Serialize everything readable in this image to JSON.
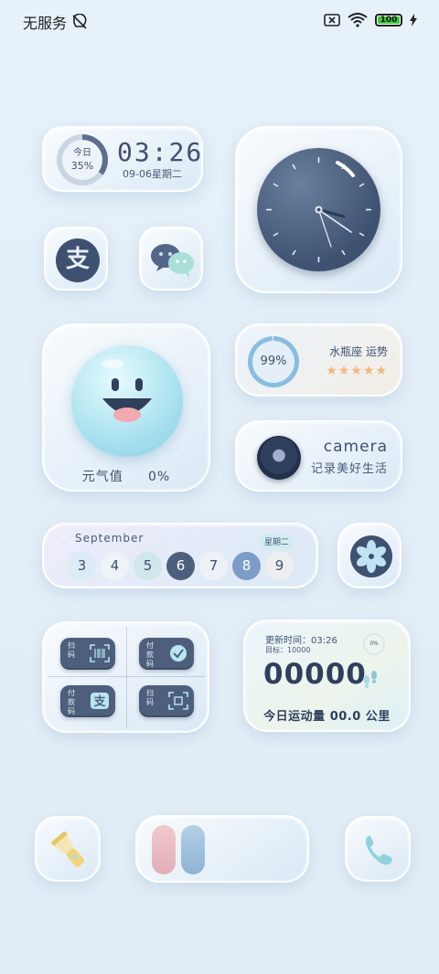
{
  "status_bar": {
    "carrier": "无服务",
    "battery_level": "100"
  },
  "time_widget": {
    "ring_label": "今日",
    "ring_percent": "35%",
    "ring_fraction": 0.35,
    "time": "03:26",
    "date": "09-06星期二"
  },
  "mood_widget": {
    "label": "元气值",
    "value": "0%"
  },
  "horoscope_widget": {
    "percent": "99%",
    "title": "水瓶座 运势",
    "stars": "★★★★★"
  },
  "camera_widget": {
    "title": "camera",
    "subtitle": "记录美好生活"
  },
  "calendar_widget": {
    "month": "September",
    "weekday": "星期二",
    "days": [
      {
        "label": "3",
        "bg": "#dcebf5",
        "fg": "#3f5170"
      },
      {
        "label": "4",
        "bg": "#eef3f8",
        "fg": "#3f5170"
      },
      {
        "label": "5",
        "bg": "#cfe7ec",
        "fg": "#3f5170"
      },
      {
        "label": "6",
        "bg": "#4d5f7c",
        "fg": "#ffffff"
      },
      {
        "label": "7",
        "bg": "#eef1f6",
        "fg": "#3f5170"
      },
      {
        "label": "8",
        "bg": "#7e9cc8",
        "fg": "#ffffff"
      },
      {
        "label": "9",
        "bg": "#eeeef0",
        "fg": "#3f5170"
      }
    ]
  },
  "pay_widget": {
    "scan_label": "扫码",
    "pay_code_label": "付款码",
    "alipay_pay_label": "付款码",
    "alipay_scan_label": "扫码"
  },
  "steps_widget": {
    "update_time": "更新时间：03:26",
    "goal": "目标：10000",
    "percent": "0%",
    "count": "00000",
    "summary": "今日运动量 00.0 公里"
  },
  "icons": {
    "alipay_glyph": "支",
    "wechat": "wechat-icon",
    "flashlight": "flashlight-icon",
    "phone": "phone-icon",
    "fan": "fan-icon"
  },
  "colors": {
    "accent_dark": "#3f5170",
    "pill_pink": "#e7b9bf",
    "pill_blue": "#9cbedb",
    "stars": "#f2b77a"
  }
}
